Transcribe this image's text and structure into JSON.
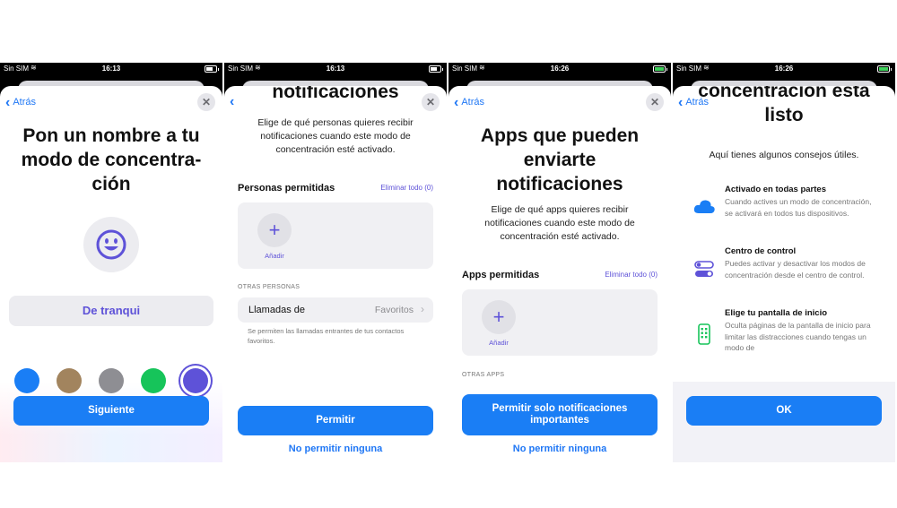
{
  "screens": [
    {
      "status": {
        "carrier": "Sin SIM",
        "time": "16:13"
      },
      "back_label": "Atrás",
      "title": "Pon un nombre a tu modo de concentra- ción",
      "name_value": "De tranqui",
      "emoji_icon": "smiley-face-icon",
      "colors": [
        "#1a7ef5",
        "#a2845e",
        "#8e8e93",
        "#16c45a",
        "#5e52d8"
      ],
      "selected_color_index": 4,
      "primary_button": "Siguiente"
    },
    {
      "status": {
        "carrier": "Sin SIM",
        "time": "16:13"
      },
      "title": "notificaciones",
      "subtitle": "Elige de qué personas quieres recibir notificaciones cuando este modo de concentración esté activado.",
      "section": {
        "title": "Personas permitidas",
        "action": "Eliminar todo (0)"
      },
      "add_label": "Añadir",
      "other_header": "OTRAS PERSONAS",
      "calls_row": {
        "label": "Llamadas de",
        "value": "Favoritos"
      },
      "footnote": "Se permiten las llamadas entrantes de tus contactos favoritos.",
      "primary_button": "Permitir",
      "secondary_button": "No permitir ninguna"
    },
    {
      "status": {
        "carrier": "Sin SIM",
        "time": "16:26"
      },
      "back_label": "Atrás",
      "title": "Apps que pueden enviarte notificaciones",
      "subtitle": "Elige de qué apps quieres recibir notificaciones cuando este modo de concentración esté activado.",
      "section": {
        "title": "Apps permitidas",
        "action": "Eliminar todo (0)"
      },
      "add_label": "Añadir",
      "other_header": "OTRAS APPS",
      "primary_button": "Permitir solo notificaciones importantes",
      "secondary_button": "No permitir ninguna"
    },
    {
      "status": {
        "carrier": "Sin SIM",
        "time": "16:26"
      },
      "back_label": "Atrás",
      "title": "concentración está listo",
      "subtitle": "Aquí tienes algunos consejos útiles.",
      "tips": [
        {
          "title": "Activado en todas partes",
          "desc": "Cuando actives un modo de concentración, se activará en todos tus dispositivos.",
          "icon": "cloud-icon"
        },
        {
          "title": "Centro de control",
          "desc": "Puedes activar y desactivar los modos de concentración desde el centro de control.",
          "icon": "toggles-icon"
        },
        {
          "title": "Elige tu pantalla de inicio",
          "desc": "Oculta páginas de la pantalla de inicio para limitar las distracciones cuando tengas un modo de",
          "icon": "phone-screen-icon"
        }
      ],
      "primary_button": "OK"
    }
  ]
}
